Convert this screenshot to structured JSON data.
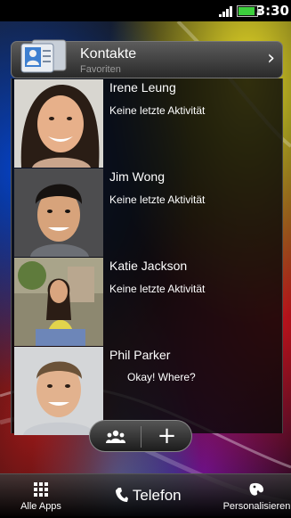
{
  "status_bar": {
    "time": "3:30",
    "battery_level": 0.8
  },
  "widget": {
    "title": "Kontakte",
    "subtitle": "Favoriten",
    "contacts": [
      {
        "name": "Irene Leung",
        "status": "Keine letzte Aktivität"
      },
      {
        "name": "Jim Wong",
        "status": "Keine letzte Aktivität"
      },
      {
        "name": "Katie Jackson",
        "status": "Keine letzte Aktivität"
      },
      {
        "name": "Phil Parker",
        "status": "Okay! Where?"
      }
    ],
    "buttons": {
      "add": "+"
    }
  },
  "dock": {
    "left": {
      "label": "Alle Apps",
      "icon": "grid-icon"
    },
    "center": {
      "label": "Telefon",
      "icon": "phone-icon"
    },
    "right": {
      "label": "Personalisieren",
      "icon": "paint-icon"
    }
  }
}
